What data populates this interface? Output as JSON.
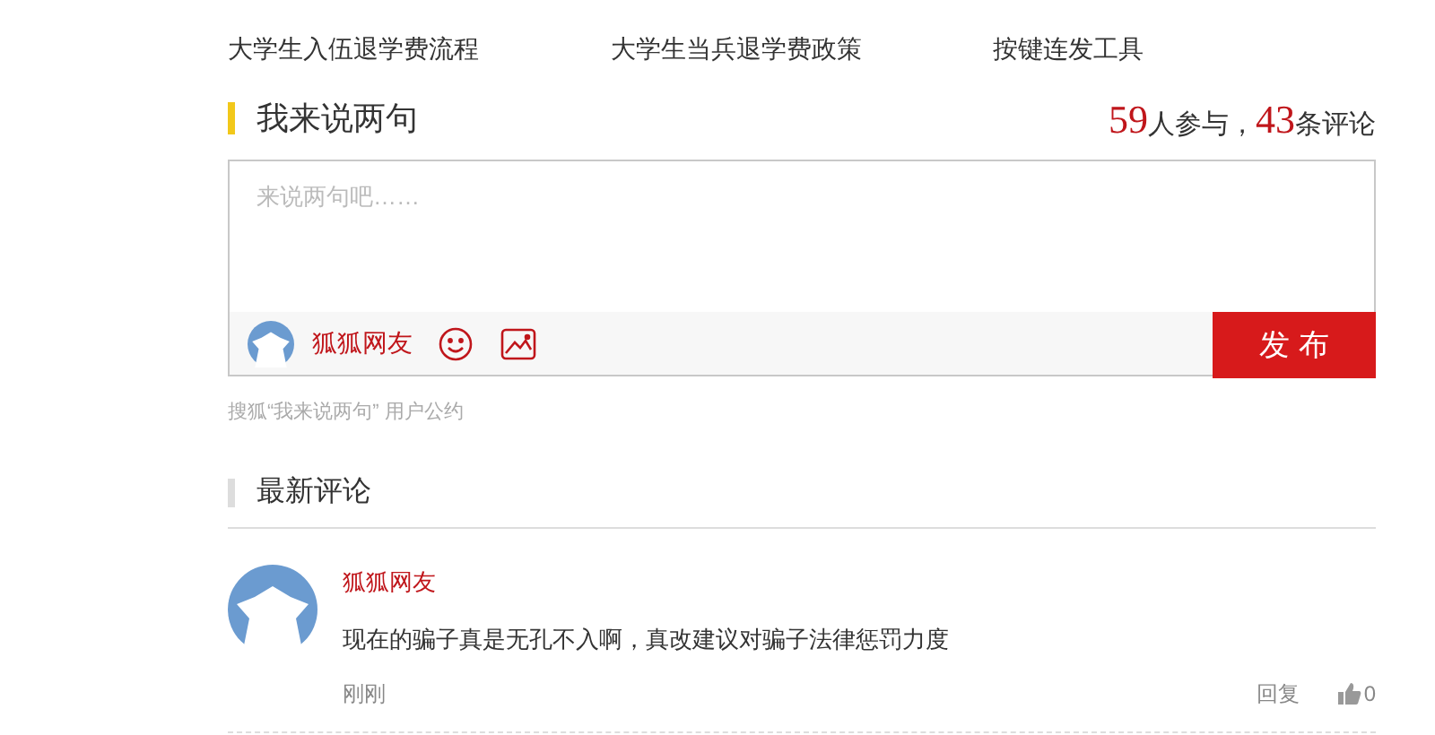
{
  "related_links": [
    "大学生入伍退学费流程",
    "大学生当兵退学费政策",
    "按键连发工具"
  ],
  "comment_box": {
    "title": "我来说两句",
    "participants": "59",
    "participants_label": "人参与，",
    "comments": "43",
    "comments_label": "条评论",
    "placeholder": "来说两句吧……",
    "user": "狐狐网友",
    "submit": "发 布",
    "terms": "搜狐“我来说两句” 用户公约"
  },
  "latest": {
    "title": "最新评论",
    "comments": [
      {
        "user": "狐狐网友",
        "text": "现在的骗子真是无孔不入啊，真改建议对骗子法律惩罚力度",
        "time": "刚刚",
        "reply": "回复",
        "likes": "0"
      }
    ]
  }
}
